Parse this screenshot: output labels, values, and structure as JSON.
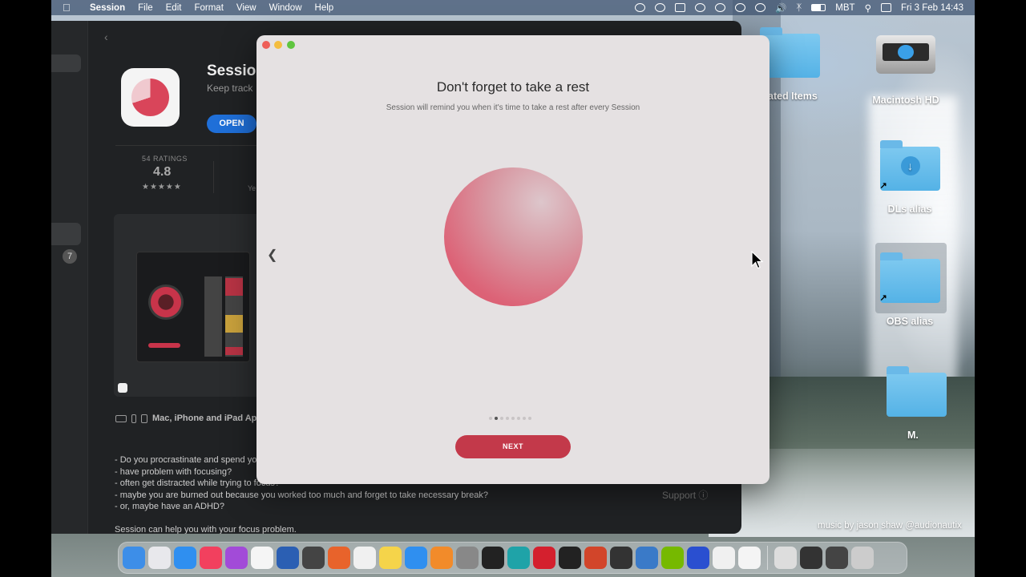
{
  "menubar": {
    "app_name": "Session",
    "menus": [
      "File",
      "Edit",
      "Format",
      "View",
      "Window",
      "Help"
    ],
    "input_source": "MBT",
    "datetime": "Fri 3 Feb  14:43"
  },
  "store": {
    "app_title": "Session",
    "app_subtitle": "Keep track",
    "open_label": "OPEN",
    "ratings_label": "54 RATINGS",
    "rating_value": "4.8",
    "stars": "★★★★★",
    "ye_fragment": "Ye",
    "sidebar_badge": "7",
    "devices_label": "Mac, iPhone and iPad Ap",
    "description_lines": [
      "- Do you procrastinate and spend yo",
      "- have problem with focusing?",
      "- often get distracted while trying to focus?",
      "- maybe you are burned out because you worked too much and forget to take necessary break?",
      "- or, maybe have an ADHD?",
      "",
      "Session can help you with your focus problem."
    ],
    "support_label": "Support"
  },
  "desktop": {
    "icons": [
      {
        "label": "ated Items"
      },
      {
        "label": "Macintosh HD"
      },
      {
        "label": "DLs alias"
      },
      {
        "label": "OBS alias"
      },
      {
        "label": "M."
      }
    ]
  },
  "modal": {
    "title": "Don't forget to take a rest",
    "subtitle": "Session will remind you when it's time to take a rest after every Session",
    "next_label": "NEXT",
    "page_count": 8,
    "current_page": 2,
    "orb_color": "#dc6377"
  },
  "credit": "music by jason shaw @audionautix",
  "dock": {
    "apps": [
      {
        "icon": "finder-icon",
        "color": "#3d8ee8"
      },
      {
        "icon": "launchpad-icon",
        "color": "#e8e8ec"
      },
      {
        "icon": "safari-icon",
        "color": "#2f8ff0"
      },
      {
        "icon": "music-icon",
        "color": "#f2405e"
      },
      {
        "icon": "podcasts-icon",
        "color": "#a24bd8"
      },
      {
        "icon": "photos-icon",
        "color": "#f5f5f5"
      },
      {
        "icon": "word-icon",
        "color": "#2b5fb3"
      },
      {
        "icon": "pixelmator-icon",
        "color": "#444"
      },
      {
        "icon": "firefox-icon",
        "color": "#e8632b"
      },
      {
        "icon": "textedit-icon",
        "color": "#f0f0f0"
      },
      {
        "icon": "notes-icon",
        "color": "#f5d44a"
      },
      {
        "icon": "app-store-icon",
        "color": "#2f8ff0"
      },
      {
        "icon": "books-icon",
        "color": "#f28b2a"
      },
      {
        "icon": "system-preferences-icon",
        "color": "#888"
      },
      {
        "icon": "obs-icon",
        "color": "#222"
      },
      {
        "icon": "edge-icon",
        "color": "#1fa3a8"
      },
      {
        "icon": "opera-icon",
        "color": "#d4202e"
      },
      {
        "icon": "activity-monitor-icon",
        "color": "#222"
      },
      {
        "icon": "powerpoint-icon",
        "color": "#d2452a"
      },
      {
        "icon": "resolve-icon",
        "color": "#333"
      },
      {
        "icon": "remote-desktop-icon",
        "color": "#3a7ac8"
      },
      {
        "icon": "nvidia-icon",
        "color": "#76b900"
      },
      {
        "icon": "soundsource-icon",
        "color": "#2a4fd0"
      },
      {
        "icon": "timing-icon",
        "color": "#f0f0f0"
      },
      {
        "icon": "session-icon",
        "color": "#f4f4f4"
      }
    ],
    "trailing": [
      {
        "icon": "document-stack-icon",
        "color": "#ddd"
      },
      {
        "icon": "screenshot-stack-icon",
        "color": "#333"
      },
      {
        "icon": "window-stack-icon",
        "color": "#444"
      },
      {
        "icon": "trash-icon",
        "color": "#ccc"
      }
    ]
  }
}
